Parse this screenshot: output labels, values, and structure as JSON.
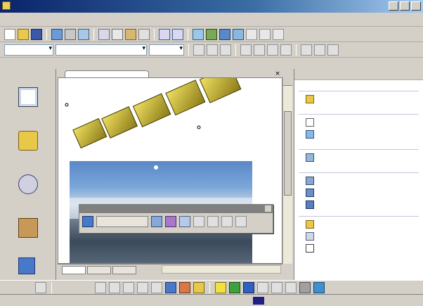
{
  "window": {
    "title": ""
  },
  "menu": {
    "items": [
      "",
      "",
      "",
      "",
      "",
      "",
      "",
      "",
      "",
      ""
    ]
  },
  "toolbar": {
    "style_combo": "",
    "font_combo": "",
    "size_combo": ""
  },
  "left_panel": {
    "title": "",
    "items": [
      {
        "icon": "page-view-icon",
        "label": ""
      },
      {
        "icon": "folder-view-icon",
        "label": ""
      },
      {
        "icon": "reports-view-icon",
        "label": ""
      },
      {
        "icon": "navigation-view-icon",
        "label": ""
      }
    ]
  },
  "editor": {
    "file_tab": "",
    "wordart_text": "",
    "view_tabs": [
      "",
      "",
      ""
    ]
  },
  "wordart_toolbar": {
    "title": "",
    "edit_text_label": ""
  },
  "task_pane": {
    "title": "",
    "sections": [
      {
        "heading": "",
        "links": [
          {
            "icon": "open-folder-icon",
            "text": ""
          }
        ]
      },
      {
        "heading": "",
        "links": [
          {
            "icon": "blank-page-icon",
            "text": ""
          },
          {
            "icon": "blank-web-icon",
            "text": ""
          }
        ]
      },
      {
        "heading": "",
        "links": [
          {
            "icon": "choose-page-icon",
            "text": ""
          }
        ]
      },
      {
        "heading": "",
        "links": [
          {
            "icon": "page-template-icon",
            "text": ""
          },
          {
            "icon": "web-template-icon",
            "text": ""
          },
          {
            "icon": "online-template-icon",
            "text": ""
          }
        ]
      }
    ],
    "footer_links": [
      {
        "icon": "add-network-place-icon",
        "text": ""
      },
      {
        "icon": "help-icon",
        "text": ""
      }
    ],
    "checkbox_label": ""
  },
  "drawing": {
    "draw_label": "",
    "autoshapes_label": ""
  },
  "status": {
    "text": ""
  }
}
